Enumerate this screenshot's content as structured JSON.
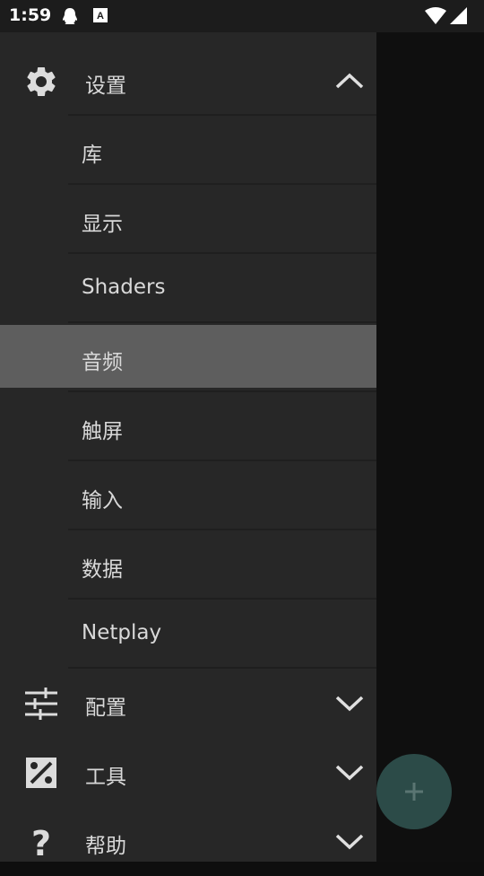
{
  "status_bar": {
    "time": "1:59",
    "icons": [
      "qq-icon",
      "keyboard-a-icon",
      "wifi-icon",
      "signal-icon"
    ]
  },
  "drawer": {
    "settings_header": {
      "label": "设置",
      "icon": "gear-icon",
      "expanded": true
    },
    "settings_items": [
      {
        "label": "库"
      },
      {
        "label": "显示"
      },
      {
        "label": "Shaders"
      },
      {
        "label": "音频",
        "selected": true
      },
      {
        "label": "触屏"
      },
      {
        "label": "输入"
      },
      {
        "label": "数据"
      },
      {
        "label": "Netplay"
      }
    ],
    "sections": [
      {
        "label": "配置",
        "icon": "sliders-icon",
        "expanded": false
      },
      {
        "label": "工具",
        "icon": "tools-icon",
        "expanded": false
      },
      {
        "label": "帮助",
        "icon": "help-icon",
        "expanded": false
      }
    ]
  },
  "fab": {
    "icon": "plus-icon"
  },
  "colors": {
    "drawer_bg": "#272727",
    "selected_bg": "#5e5e5e",
    "fab_bg": "#2c4b48"
  }
}
